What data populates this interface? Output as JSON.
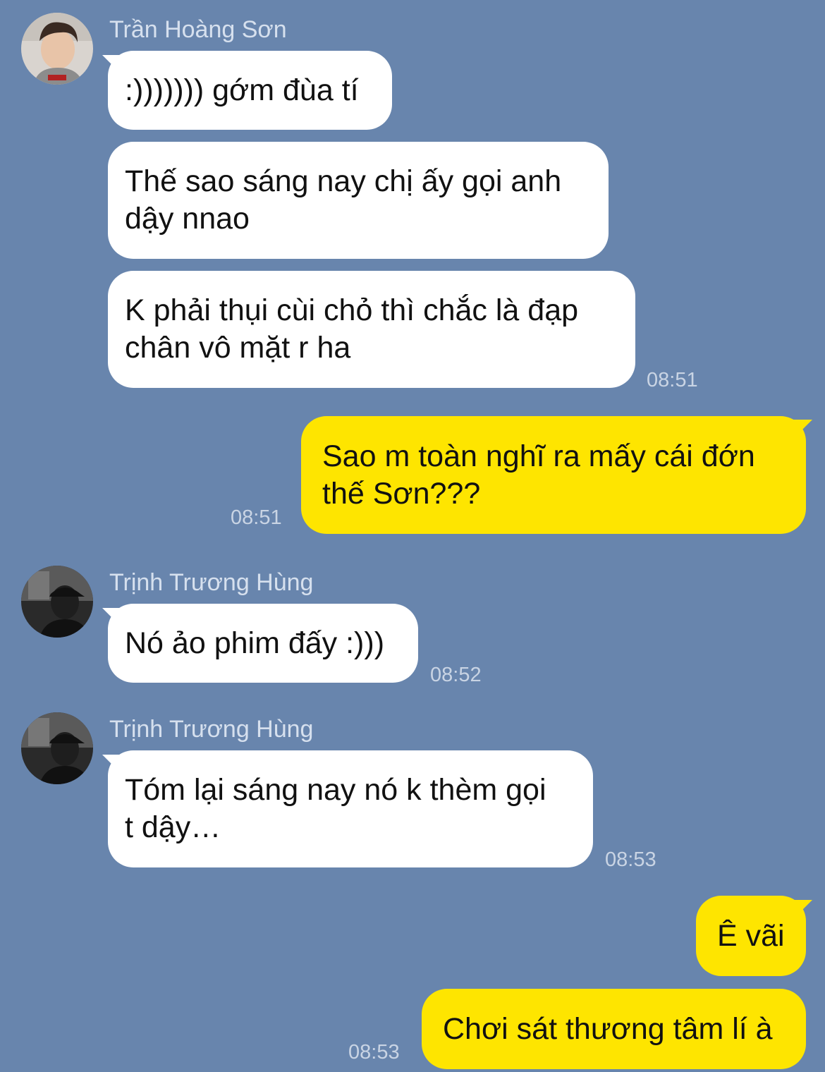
{
  "messages": [
    {
      "sender": "Trần Hoàng Sơn",
      "text": ":))))))) gớm đùa tí"
    },
    {
      "text": "Thế sao sáng nay chị ấy gọi anh\ndậy nnao"
    },
    {
      "text": "K phải thụi cùi chỏ thì chắc là đạp\nchân vô mặt r ha",
      "time": "08:51"
    },
    {
      "text": "Sao m toàn nghĩ ra mấy cái đớn\nthế Sơn???",
      "time": "08:51"
    },
    {
      "sender": "Trịnh Trương Hùng",
      "text": "Nó ảo phim đấy :)))",
      "time": "08:52"
    },
    {
      "sender": "Trịnh Trương Hùng",
      "text": "Tóm lại sáng nay nó k thèm gọi\nt dậy…",
      "time": "08:53"
    },
    {
      "text": "Ê vãi"
    },
    {
      "text": "Chơi sát thương tâm lí à",
      "time": "08:53"
    }
  ]
}
